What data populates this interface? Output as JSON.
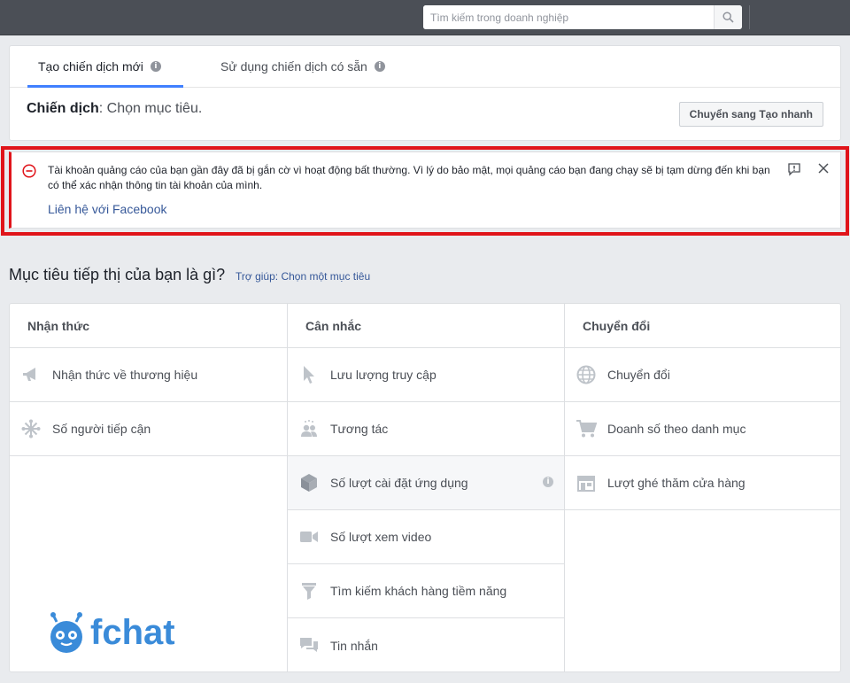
{
  "search": {
    "placeholder": "Tìm kiếm trong doanh nghiệp",
    "icon": "search-icon"
  },
  "tabs": [
    {
      "label": "Tạo chiến dịch mới",
      "active": true
    },
    {
      "label": "Sử dụng chiến dịch có sẵn",
      "active": false
    }
  ],
  "campaign": {
    "label": "Chiến dịch",
    "hint": ": Chọn mục tiêu."
  },
  "quick_create_button": "Chuyển sang Tạo nhanh",
  "alert": {
    "message": "Tài khoản quảng cáo của bạn gần đây đã bị gắn cờ vì hoạt động bất thường. Vì lý do bảo mật, mọi quảng cáo bạn đang chạy sẽ bị tạm dừng đến khi bạn có thể xác nhận thông tin tài khoản của mình.",
    "link": "Liên hệ với Facebook",
    "accent_color": "#e0141a"
  },
  "question": "Mục tiêu tiếp thị của bạn là gì?",
  "help_link": "Trợ giúp: Chọn một mục tiêu",
  "columns": [
    {
      "title": "Nhận thức",
      "items": [
        {
          "label": "Nhận thức về thương hiệu",
          "icon": "megaphone-icon"
        },
        {
          "label": "Số người tiếp cận",
          "icon": "reach-icon"
        }
      ]
    },
    {
      "title": "Cân nhắc",
      "items": [
        {
          "label": "Lưu lượng truy cập",
          "icon": "cursor-icon"
        },
        {
          "label": "Tương tác",
          "icon": "people-icon"
        },
        {
          "label": "Số lượt cài đặt ứng dụng",
          "icon": "box-icon"
        },
        {
          "label": "Số lượt xem video",
          "icon": "video-camera-icon"
        },
        {
          "label": "Tìm kiếm khách hàng tiềm năng",
          "icon": "funnel-icon"
        },
        {
          "label": "Tin nhắn",
          "icon": "chat-bubbles-icon"
        }
      ]
    },
    {
      "title": "Chuyển đổi",
      "items": [
        {
          "label": "Chuyển đổi",
          "icon": "globe-icon"
        },
        {
          "label": "Doanh số theo danh mục",
          "icon": "cart-icon"
        },
        {
          "label": "Lượt ghé thăm cửa hàng",
          "icon": "store-icon"
        }
      ]
    }
  ],
  "logo": {
    "text": "fchat"
  },
  "info_symbol": "i"
}
